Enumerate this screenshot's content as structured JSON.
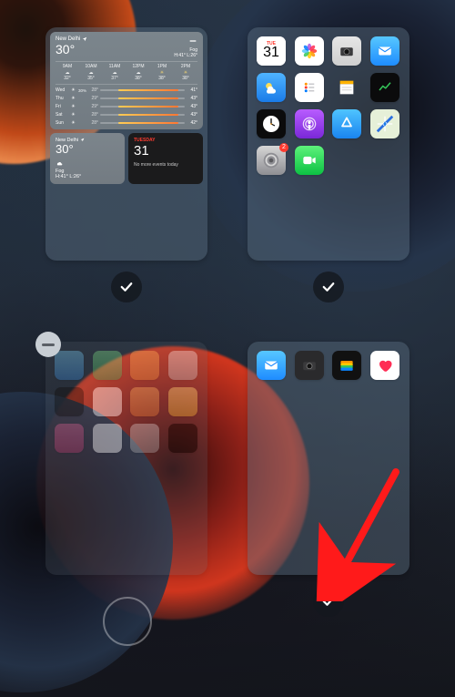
{
  "pages": [
    "widgets-page",
    "apps-page-1",
    "apps-page-2",
    "apps-page-3"
  ],
  "page_visibility": {
    "page1": true,
    "page2": true,
    "page3": false,
    "page4": true
  },
  "weather": {
    "location": "New Delhi",
    "temp": "30°",
    "condition": "Fog",
    "high_low": "H:41° L:26°",
    "hourly": [
      {
        "label": "9AM",
        "temp": "32°",
        "sunny": false
      },
      {
        "label": "10AM",
        "temp": "35°",
        "sunny": false
      },
      {
        "label": "11AM",
        "temp": "37°",
        "sunny": false
      },
      {
        "label": "12PM",
        "temp": "38°",
        "sunny": false
      },
      {
        "label": "1PM",
        "temp": "38°",
        "sunny": true
      },
      {
        "label": "2PM",
        "temp": "38°",
        "sunny": true
      }
    ],
    "daily": [
      {
        "name": "Wed",
        "pct": "30%",
        "lo": "28°",
        "hi": "41°"
      },
      {
        "name": "Thu",
        "pct": "",
        "lo": "29°",
        "hi": "43°"
      },
      {
        "name": "Fri",
        "pct": "",
        "lo": "29°",
        "hi": "43°"
      },
      {
        "name": "Sat",
        "pct": "",
        "lo": "28°",
        "hi": "43°"
      },
      {
        "name": "Sun",
        "pct": "",
        "lo": "28°",
        "hi": "42°"
      }
    ],
    "small": {
      "location": "New Delhi",
      "temp": "30°",
      "condition": "Fog",
      "high_low": "H:41° L:26°"
    }
  },
  "calendar": {
    "dow": "Tuesday",
    "date": "31",
    "text": "No more events today"
  },
  "cal_icon": {
    "dow": "TUE",
    "date": "31"
  },
  "apps_p2": [
    {
      "name": "calendar-app-icon"
    },
    {
      "name": "photos-app-icon"
    },
    {
      "name": "camera-app-icon",
      "bg": "linear-gradient(180deg,#e6e6e6,#cfcfcf)"
    },
    {
      "name": "mail-app-icon",
      "bg": "linear-gradient(180deg,#57c7ff,#1e8cff)"
    },
    {
      "name": "weather-app-icon",
      "bg": "linear-gradient(180deg,#4fb4ff,#1a7be8)"
    },
    {
      "name": "reminders-app-icon",
      "bg": "#fff"
    },
    {
      "name": "notes-app-icon",
      "bg": "linear-gradient(180deg,#ffe37a,#ffd23d)"
    },
    {
      "name": "stocks-app-icon",
      "bg": "#0b0b0c"
    },
    {
      "name": "clock-app-icon"
    },
    {
      "name": "podcasts-app-icon",
      "bg": "linear-gradient(180deg,#b85cff,#7a28d8)"
    },
    {
      "name": "appstore-app-icon",
      "bg": "linear-gradient(180deg,#4fc4ff,#1a84ef)"
    },
    {
      "name": "maps-app-icon",
      "bg": "linear-gradient(135deg,#6ee37a,#ffe066 40%,#3faaf6 70%,#ff6a5b)"
    },
    {
      "name": "settings-app-icon",
      "bg": "linear-gradient(180deg,#d6d6d6,#8e8e93)",
      "badge": "2"
    },
    {
      "name": "facetime-app-icon",
      "bg": "linear-gradient(180deg,#5df27b,#0dc143)"
    }
  ],
  "apps_p3": [
    {
      "bg": "linear-gradient(180deg,#55c8ff,#1f90ff)"
    },
    {
      "bg": "linear-gradient(180deg,#5ee36b,#18b94c)"
    },
    {
      "bg": "linear-gradient(180deg,#ffaa33,#ff8a1e)"
    },
    {
      "bg": "linear-gradient(180deg,#d9d9dd,#b9b9be)"
    },
    {
      "bg": "#222"
    },
    {
      "bg": "#fff"
    },
    {
      "bg": "linear-gradient(180deg,#ffac3e,#ff7a1e)"
    },
    {
      "bg": "linear-gradient(180deg,#ffd850,#ffb300)"
    },
    {
      "bg": "linear-gradient(180deg,#ff5aa2,#e73b88)"
    },
    {
      "bg": "#fff"
    },
    {
      "bg": "linear-gradient(180deg,#c8c8cc,#a6a6aa)"
    },
    {
      "bg": "#111"
    }
  ],
  "apps_p4": [
    {
      "name": "mail-app-icon",
      "bg": "linear-gradient(180deg,#57c7ff,#1e8cff)",
      "glyph": "env"
    },
    {
      "name": "camera-app-icon",
      "bg": "#2a2a2c",
      "glyph": "cam"
    },
    {
      "name": "wallet-app-icon",
      "bg": "#111",
      "glyph": "wallet"
    },
    {
      "name": "health-app-icon",
      "bg": "#fff",
      "glyph": "heart"
    }
  ]
}
